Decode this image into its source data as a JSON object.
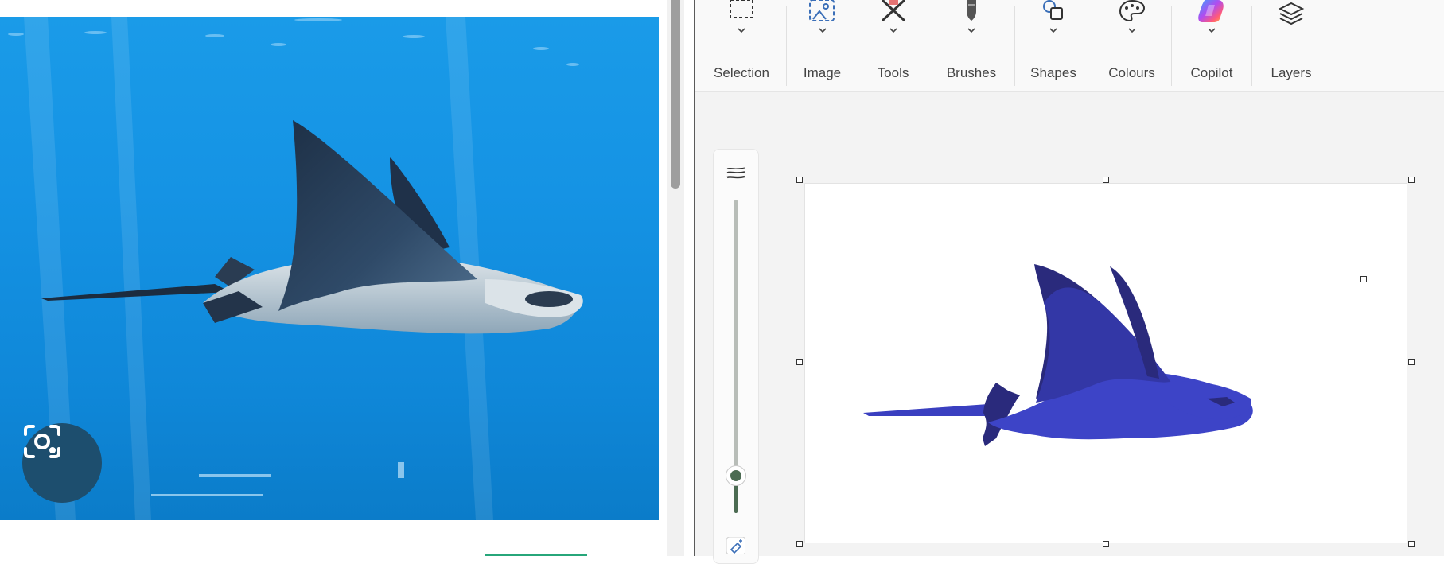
{
  "browser": {
    "image_alt": "Eagle ray swimming in blue aquarium water",
    "lens_button_label": "Search with Google Lens"
  },
  "paint": {
    "ribbon": {
      "groups": [
        {
          "id": "selection",
          "label": "Selection",
          "icon": "selection-icon",
          "has_dropdown": true
        },
        {
          "id": "image",
          "label": "Image",
          "icon": "image-icon",
          "has_dropdown": true
        },
        {
          "id": "tools",
          "label": "Tools",
          "icon": "tools-icon",
          "has_dropdown": true
        },
        {
          "id": "brushes",
          "label": "Brushes",
          "icon": "brush-icon",
          "has_dropdown": true
        },
        {
          "id": "shapes",
          "label": "Shapes",
          "icon": "shapes-icon",
          "has_dropdown": true
        },
        {
          "id": "colours",
          "label": "Colours",
          "icon": "palette-icon",
          "has_dropdown": true
        },
        {
          "id": "copilot",
          "label": "Copilot",
          "icon": "copilot-icon",
          "has_dropdown": true
        },
        {
          "id": "layers",
          "label": "Layers",
          "icon": "layers-icon",
          "has_dropdown": false
        }
      ]
    },
    "size_slider": {
      "value_fraction": 0.12
    },
    "drawing_colors": {
      "outline_dark": "#2a2a7c",
      "body_mid": "#3337a6",
      "body_light": "#3d44c7",
      "tail": "#3a3fc0"
    },
    "accent": "#4b6b52"
  }
}
